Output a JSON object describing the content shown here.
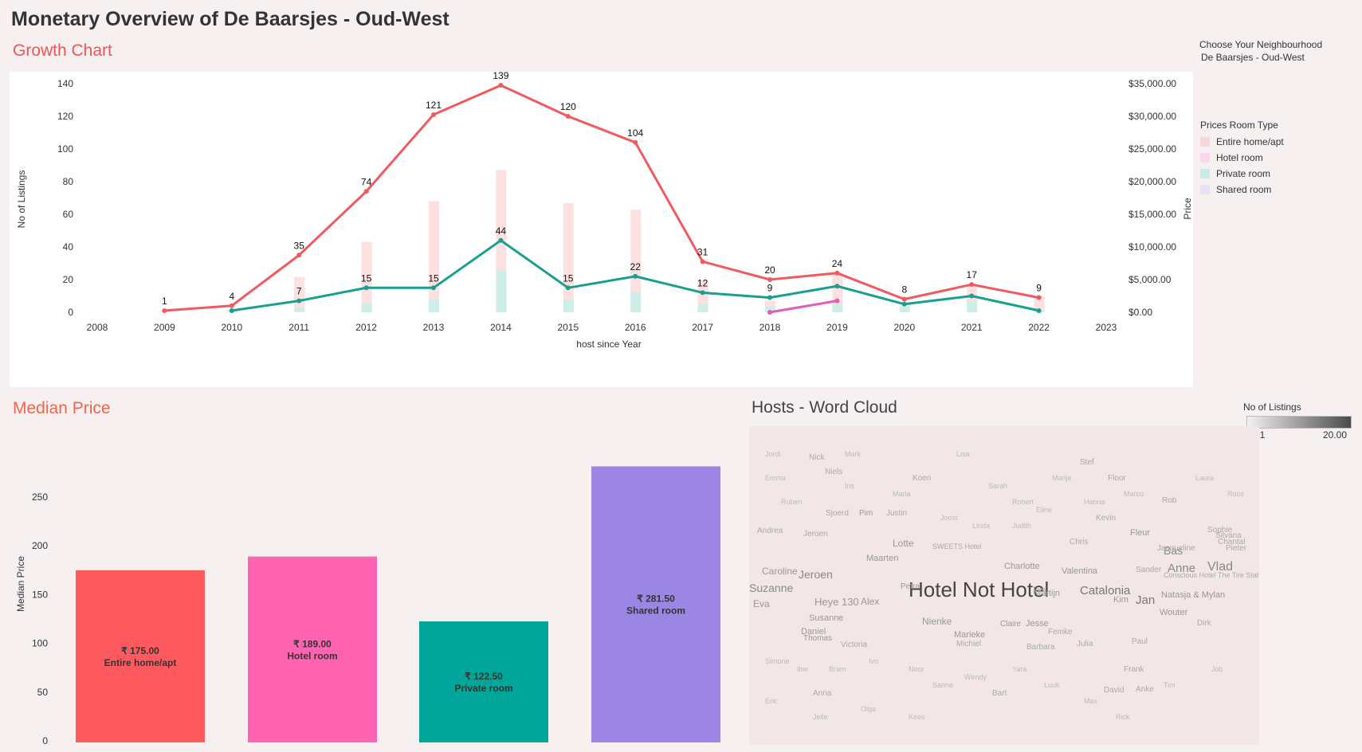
{
  "dashboard_title": "Monetary Overview of De Baarsjes - Oud-West",
  "filter": {
    "label": "Choose Your Neighbourhood",
    "value": "De Baarsjes - Oud-West"
  },
  "room_legend": {
    "title": "Prices Room Type",
    "items": [
      {
        "label": "Entire home/apt",
        "color": "#f8d7d9"
      },
      {
        "label": "Hotel room",
        "color": "#fcd6ea"
      },
      {
        "label": "Private room",
        "color": "#c9ebe6"
      },
      {
        "label": "Shared room",
        "color": "#e6e3f7"
      }
    ]
  },
  "growth": {
    "title": "Growth Chart",
    "xlabel": "host since Year",
    "ylabel_left": "No of Listings",
    "ylabel_right": "Price",
    "left_ticks": [
      "140",
      "120",
      "100",
      "80",
      "60",
      "40",
      "20",
      "0"
    ],
    "right_ticks": [
      "$35,000.00",
      "$30,000.00",
      "$25,000.00",
      "$20,000.00",
      "$15,000.00",
      "$10,000.00",
      "$5,000.00",
      "$0.00"
    ],
    "x_ticks": [
      "2008",
      "2009",
      "2010",
      "2011",
      "2012",
      "2013",
      "2014",
      "2015",
      "2016",
      "2017",
      "2018",
      "2019",
      "2020",
      "2021",
      "2022",
      "2023"
    ]
  },
  "chart_data": [
    {
      "type": "line",
      "title": "Growth Chart",
      "xlabel": "host since Year",
      "ylabel": "No of Listings",
      "y2label": "Price",
      "xlim": [
        2008,
        2023
      ],
      "ylim": [
        0,
        140
      ],
      "y2lim": [
        0,
        35000
      ],
      "series": [
        {
          "name": "Entire home/apt",
          "axis": "left",
          "color": "#f05a5f",
          "x": [
            2009,
            2010,
            2011,
            2012,
            2013,
            2014,
            2015,
            2016,
            2017,
            2018,
            2019,
            2020,
            2021,
            2022
          ],
          "values": [
            1,
            4,
            35,
            74,
            121,
            139,
            120,
            104,
            31,
            20,
            24,
            8,
            17,
            9
          ]
        },
        {
          "name": "Private room",
          "axis": "left",
          "color": "#18a08f",
          "x": [
            2010,
            2011,
            2012,
            2013,
            2014,
            2015,
            2016,
            2017,
            2018,
            2019,
            2020,
            2021,
            2022
          ],
          "values": [
            1,
            7,
            15,
            15,
            44,
            15,
            22,
            12,
            9,
            16,
            5,
            10,
            1
          ],
          "labels": {
            "2011": "7",
            "2012": "15",
            "2013": "15",
            "2014": "44",
            "2015": "15",
            "2016": "22",
            "2017": "12",
            "2018": "9"
          }
        },
        {
          "name": "Hotel room",
          "axis": "left",
          "color": "#e55bb8",
          "x": [
            2018,
            2019
          ],
          "values": [
            0,
            7
          ]
        }
      ],
      "bars": [
        {
          "name": "Entire home/apt",
          "axis": "right",
          "color": "#fde0e0",
          "x": [
            2009,
            2010,
            2011,
            2012,
            2013,
            2014,
            2015,
            2016,
            2017,
            2018,
            2019,
            2020,
            2021,
            2022
          ],
          "values": [
            100,
            500,
            5400,
            10800,
            17000,
            21800,
            16700,
            15700,
            5000,
            1800,
            5900,
            1000,
            4200,
            2500
          ]
        },
        {
          "name": "Private room",
          "axis": "right",
          "color": "#cdeee9",
          "x": [
            2010,
            2011,
            2012,
            2013,
            2014,
            2015,
            2016,
            2017,
            2018,
            2019,
            2020,
            2021,
            2022
          ],
          "values": [
            100,
            700,
            1400,
            1900,
            6400,
            1900,
            3100,
            1300,
            900,
            1300,
            900,
            1700,
            300
          ]
        }
      ]
    },
    {
      "type": "bar",
      "title": "Median Price",
      "ylabel": "Median Price",
      "ylim": [
        0,
        300
      ],
      "yticks": [
        "250",
        "200",
        "150",
        "100",
        "50",
        "0"
      ],
      "categories": [
        "Entire home/apt",
        "Hotel room",
        "Private room",
        "Shared room"
      ],
      "values": [
        175.0,
        189.0,
        122.5,
        281.5
      ],
      "value_labels": [
        "₹ 175.00",
        "₹ 189.00",
        "₹ 122.50",
        "₹ 281.50"
      ],
      "colors": [
        "#ff5a5f",
        "#ff64b1",
        "#00a699",
        "#9b87e3"
      ]
    }
  ],
  "median": {
    "title": "Median Price",
    "ylabel": "Median Price"
  },
  "wordcloud": {
    "title": "Hosts - Word Cloud",
    "legend_title": "No of Listings",
    "legend_min": "0.61",
    "legend_max": "20.00",
    "words": [
      {
        "t": "Hotel Not Hotel",
        "s": 26,
        "c": "#444"
      },
      {
        "t": "Catalonia",
        "s": 15,
        "c": "#777"
      },
      {
        "t": "Suzanne",
        "s": 14,
        "c": "#888"
      },
      {
        "t": "Jeroen",
        "s": 14,
        "c": "#888"
      },
      {
        "t": "Vlad",
        "s": 16,
        "c": "#888"
      },
      {
        "t": "Anne",
        "s": 15,
        "c": "#888"
      },
      {
        "t": "Jan",
        "s": 15,
        "c": "#777"
      },
      {
        "t": "Bas",
        "s": 14,
        "c": "#888"
      },
      {
        "t": "Caroline",
        "s": 12,
        "c": "#999"
      },
      {
        "t": "Heye 130",
        "s": 13,
        "c": "#999"
      },
      {
        "t": "Alex",
        "s": 12,
        "c": "#999"
      },
      {
        "t": "Eva",
        "s": 12,
        "c": "#999"
      },
      {
        "t": "Susanne",
        "s": 11,
        "c": "#999"
      },
      {
        "t": "Daniel",
        "s": 11,
        "c": "#999"
      },
      {
        "t": "Maarten",
        "s": 11,
        "c": "#999"
      },
      {
        "t": "Lotte",
        "s": 12,
        "c": "#999"
      },
      {
        "t": "Nienke",
        "s": 12,
        "c": "#999"
      },
      {
        "t": "Marieke",
        "s": 11,
        "c": "#999"
      },
      {
        "t": "Valentina",
        "s": 11,
        "c": "#999"
      },
      {
        "t": "Charlotte",
        "s": 11,
        "c": "#999"
      },
      {
        "t": "Martijn",
        "s": 11,
        "c": "#999"
      },
      {
        "t": "Kim",
        "s": 11,
        "c": "#999"
      },
      {
        "t": "Natasja & Mylan",
        "s": 11,
        "c": "#999"
      },
      {
        "t": "Wouter",
        "s": 11,
        "c": "#999"
      },
      {
        "t": "Fleur",
        "s": 11,
        "c": "#999"
      },
      {
        "t": "Jesse",
        "s": 11,
        "c": "#999"
      },
      {
        "t": "Claire",
        "s": 10,
        "c": "#999"
      },
      {
        "t": "Petra",
        "s": 10,
        "c": "#999"
      },
      {
        "t": "Thomas",
        "s": 10,
        "c": "#999"
      },
      {
        "t": "Pim",
        "s": 10,
        "c": "#999"
      },
      {
        "t": "Sjoerd",
        "s": 10,
        "c": "#aaa"
      },
      {
        "t": "Andrea",
        "s": 10,
        "c": "#aaa"
      },
      {
        "t": "Koen",
        "s": 10,
        "c": "#aaa"
      },
      {
        "t": "Stef",
        "s": 10,
        "c": "#aaa"
      },
      {
        "t": "Julia",
        "s": 10,
        "c": "#aaa"
      },
      {
        "t": "Paul",
        "s": 10,
        "c": "#aaa"
      },
      {
        "t": "Sander",
        "s": 10,
        "c": "#aaa"
      },
      {
        "t": "Barbara",
        "s": 10,
        "c": "#aaa"
      },
      {
        "t": "Michiel",
        "s": 10,
        "c": "#aaa"
      },
      {
        "t": "Frank",
        "s": 10,
        "c": "#aaa"
      },
      {
        "t": "Anke",
        "s": 10,
        "c": "#aaa"
      },
      {
        "t": "David",
        "s": 10,
        "c": "#aaa"
      },
      {
        "t": "Sophie",
        "s": 10,
        "c": "#aaa"
      },
      {
        "t": "Silvana",
        "s": 10,
        "c": "#aaa"
      },
      {
        "t": "Pieter",
        "s": 10,
        "c": "#aaa"
      },
      {
        "t": "Chantal",
        "s": 10,
        "c": "#aaa"
      },
      {
        "t": "Kevin",
        "s": 10,
        "c": "#aaa"
      },
      {
        "t": "Justin",
        "s": 10,
        "c": "#aaa"
      },
      {
        "t": "Niels",
        "s": 10,
        "c": "#aaa"
      },
      {
        "t": "Nick",
        "s": 10,
        "c": "#aaa"
      },
      {
        "t": "Anna",
        "s": 10,
        "c": "#aaa"
      },
      {
        "t": "Victoria",
        "s": 10,
        "c": "#aaa"
      },
      {
        "t": "Femke",
        "s": 10,
        "c": "#aaa"
      },
      {
        "t": "Dirk",
        "s": 10,
        "c": "#aaa"
      },
      {
        "t": "Jacqueline",
        "s": 10,
        "c": "#aaa"
      },
      {
        "t": "Rob",
        "s": 10,
        "c": "#aaa"
      },
      {
        "t": "Floor",
        "s": 10,
        "c": "#aaa"
      },
      {
        "t": "Chris",
        "s": 10,
        "c": "#aaa"
      },
      {
        "t": "Bart",
        "s": 10,
        "c": "#aaa"
      },
      {
        "t": "Jeroen",
        "s": 10,
        "c": "#aaa"
      },
      {
        "t": "Conscious Hotel The Tire Station",
        "s": 9,
        "c": "#aaa"
      },
      {
        "t": "SWEETS Hotel",
        "s": 9,
        "c": "#aaa"
      },
      {
        "t": "Tom",
        "s": 9,
        "c": "#aaa"
      },
      {
        "t": "Jordi",
        "s": 9,
        "c": "#bbb"
      },
      {
        "t": "Mark",
        "s": 9,
        "c": "#bbb"
      },
      {
        "t": "Lisa",
        "s": 9,
        "c": "#bbb"
      },
      {
        "t": "Sarah",
        "s": 9,
        "c": "#bbb"
      },
      {
        "t": "Robert",
        "s": 9,
        "c": "#bbb"
      },
      {
        "t": "Marije",
        "s": 9,
        "c": "#bbb"
      },
      {
        "t": "Laura",
        "s": 9,
        "c": "#bbb"
      },
      {
        "t": "Roos",
        "s": 9,
        "c": "#bbb"
      },
      {
        "t": "Emma",
        "s": 9,
        "c": "#bbb"
      },
      {
        "t": "Ruben",
        "s": 9,
        "c": "#bbb"
      },
      {
        "t": "Iris",
        "s": 9,
        "c": "#bbb"
      },
      {
        "t": "Maria",
        "s": 9,
        "c": "#bbb"
      },
      {
        "t": "Joost",
        "s": 9,
        "c": "#bbb"
      },
      {
        "t": "Linda",
        "s": 9,
        "c": "#bbb"
      },
      {
        "t": "Judith",
        "s": 9,
        "c": "#bbb"
      },
      {
        "t": "Eline",
        "s": 9,
        "c": "#bbb"
      },
      {
        "t": "Hanna",
        "s": 9,
        "c": "#bbb"
      },
      {
        "t": "Marco",
        "s": 9,
        "c": "#bbb"
      },
      {
        "t": "Simone",
        "s": 9,
        "c": "#bbb"
      },
      {
        "t": "Ilse",
        "s": 9,
        "c": "#bbb"
      },
      {
        "t": "Bram",
        "s": 9,
        "c": "#bbb"
      },
      {
        "t": "Ivo",
        "s": 9,
        "c": "#bbb"
      },
      {
        "t": "Noor",
        "s": 9,
        "c": "#bbb"
      },
      {
        "t": "Sanne",
        "s": 9,
        "c": "#bbb"
      },
      {
        "t": "Wendy",
        "s": 9,
        "c": "#bbb"
      },
      {
        "t": "Yara",
        "s": 9,
        "c": "#bbb"
      },
      {
        "t": "Luuk",
        "s": 9,
        "c": "#bbb"
      },
      {
        "t": "Max",
        "s": 9,
        "c": "#bbb"
      },
      {
        "t": "Rick",
        "s": 9,
        "c": "#bbb"
      },
      {
        "t": "Tim",
        "s": 9,
        "c": "#bbb"
      },
      {
        "t": "Job",
        "s": 9,
        "c": "#bbb"
      },
      {
        "t": "Eric",
        "s": 9,
        "c": "#bbb"
      },
      {
        "t": "Jelle",
        "s": 9,
        "c": "#bbb"
      },
      {
        "t": "Olga",
        "s": 9,
        "c": "#bbb"
      },
      {
        "t": "Kees",
        "s": 9,
        "c": "#bbb"
      }
    ]
  }
}
